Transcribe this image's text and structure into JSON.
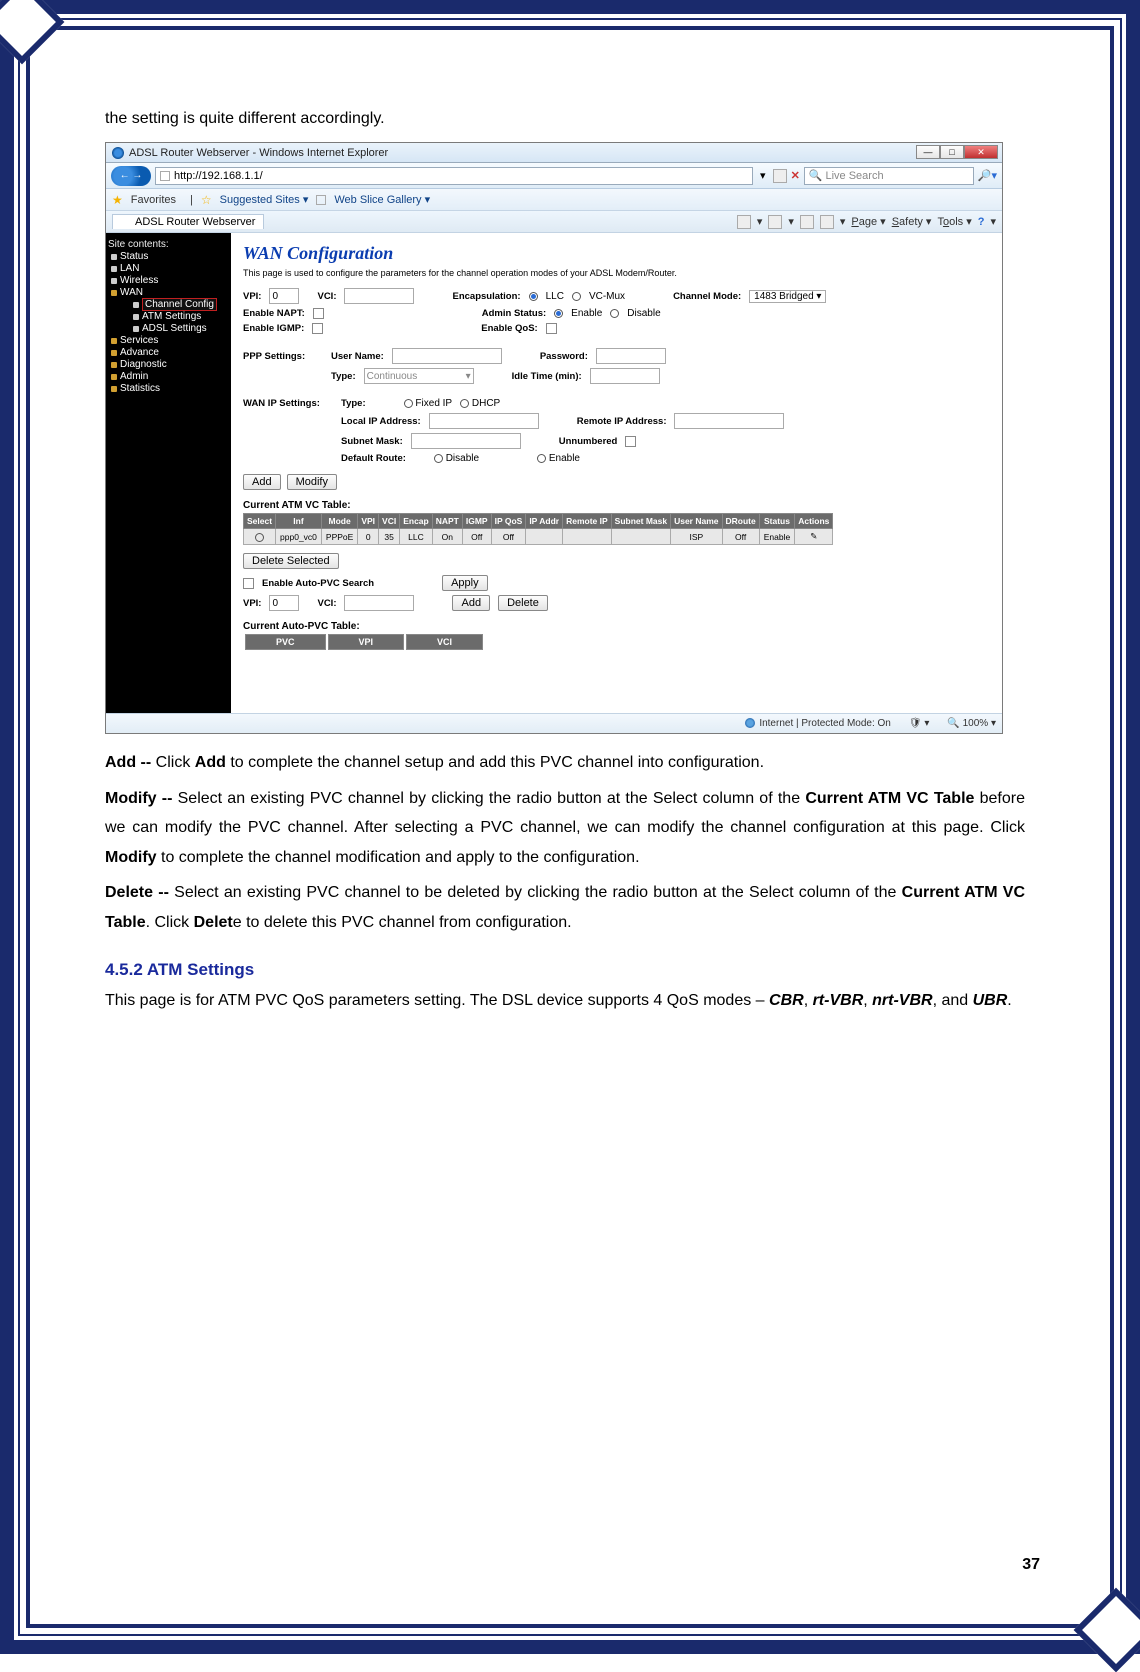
{
  "page_number": "37",
  "intro": "the setting is quite different accordingly.",
  "browser": {
    "title": "ADSL Router Webserver - Windows Internet Explorer",
    "url": "http://192.168.1.1/",
    "search_placeholder": "Live Search",
    "fav_label": "Favorites",
    "suggested": "Suggested Sites",
    "web_slice": "Web Slice Gallery",
    "tab_title": "ADSL Router Webserver",
    "cmd_page": "Page",
    "cmd_safety": "Safety",
    "cmd_tools": "Tools",
    "status_text": "Internet | Protected Mode: On",
    "zoom": "100%"
  },
  "sidebar": {
    "title": "Site contents:",
    "items": [
      "Status",
      "LAN",
      "Wireless",
      "WAN",
      "Channel Config",
      "ATM Settings",
      "ADSL Settings",
      "Services",
      "Advance",
      "Diagnostic",
      "Admin",
      "Statistics"
    ]
  },
  "wan": {
    "heading": "WAN Configuration",
    "sub": "This page is used to configure the parameters for the channel operation modes of your ADSL Modem/Router.",
    "vpi_label": "VPI:",
    "vpi_value": "0",
    "vci_label": "VCI:",
    "encap_label": "Encapsulation:",
    "encap_llc": "LLC",
    "encap_vcmux": "VC-Mux",
    "chmode_label": "Channel Mode:",
    "chmode_value": "1483 Bridged",
    "napt_label": "Enable NAPT:",
    "admin_label": "Admin Status:",
    "admin_enable": "Enable",
    "admin_disable": "Disable",
    "igmp_label": "Enable IGMP:",
    "qos_label": "Enable QoS:",
    "ppp_label": "PPP Settings:",
    "ppp_user": "User Name:",
    "ppp_pass": "Password:",
    "ppp_type": "Type:",
    "ppp_type_val": "Continuous",
    "ppp_idle": "Idle Time (min):",
    "wanip_label": "WAN IP Settings:",
    "wanip_type": "Type:",
    "wanip_fixed": "Fixed IP",
    "wanip_dhcp": "DHCP",
    "wanip_local": "Local IP Address:",
    "wanip_remote": "Remote IP Address:",
    "wanip_subnet": "Subnet Mask:",
    "wanip_unnum": "Unnumbered",
    "wanip_droute": "Default Route:",
    "wanip_dr_disable": "Disable",
    "wanip_dr_enable": "Enable",
    "btn_add": "Add",
    "btn_modify": "Modify",
    "table_title": "Current ATM VC Table:",
    "headers": [
      "Select",
      "Inf",
      "Mode",
      "VPI",
      "VCI",
      "Encap",
      "NAPT",
      "IGMP",
      "IP QoS",
      "IP Addr",
      "Remote IP",
      "Subnet Mask",
      "User Name",
      "DRoute",
      "Status",
      "Actions"
    ],
    "row": [
      "",
      "ppp0_vc0",
      "PPPoE",
      "0",
      "35",
      "LLC",
      "On",
      "Off",
      "Off",
      "",
      "",
      "",
      "ISP",
      "Off",
      "Enable",
      ""
    ],
    "del_sel": "Delete Selected",
    "auto_pvc_chk": "Enable Auto-PVC Search",
    "apply": "Apply",
    "vpi2_label": "VPI:",
    "vpi2_value": "0",
    "vci2_label": "VCI:",
    "add2": "Add",
    "delete2": "Delete",
    "auto_pvc_title": "Current Auto-PVC Table:",
    "auto_pvc_headers": [
      "PVC",
      "VPI",
      "VCI"
    ]
  },
  "doc": {
    "add_label": "Add --",
    "add_text": " Click ",
    "add_btn": "Add",
    "add_rest": " to complete the channel setup and add this PVC channel into configuration.",
    "modify_label": "Modify --",
    "modify_t1": " Select an existing PVC channel by clicking the radio button at the Select column of the ",
    "modify_b1": "Current ATM VC Table",
    "modify_t2": " before we can modify the PVC channel. After selecting a PVC channel, we can modify the channel configuration at this page. Click ",
    "modify_b2": "Modify",
    "modify_t3": " to complete the channel modification and apply to the configuration.",
    "delete_label": "Delete --",
    "delete_t1": " Select an existing PVC channel to be deleted by clicking the radio button at the Select column of the ",
    "delete_b1": "Current ATM VC Table",
    "delete_t2": ". Click ",
    "delete_b2": "Delet",
    "delete_t3": "e to delete this PVC channel from configuration.",
    "heading": "4.5.2 ATM Settings",
    "atm_para_1": "This page is for ATM PVC QoS parameters setting. The DSL device supports 4 QoS modes – ",
    "atm_em_1": "CBR",
    "atm_em_2": "rt-VBR",
    "atm_em_3": "nrt-VBR",
    "atm_em_4": "UBR",
    "comma": ", ",
    "and": ", and ",
    "period": "."
  }
}
